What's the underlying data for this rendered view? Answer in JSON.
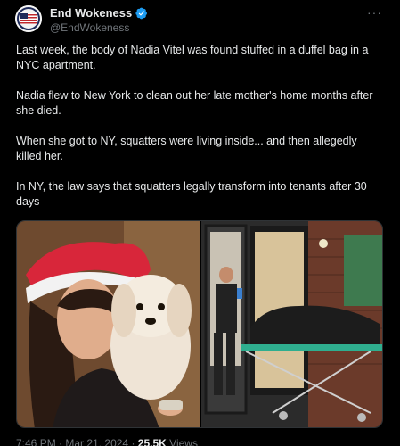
{
  "tweet": {
    "display_name": "End Wokeness",
    "handle": "@EndWokeness",
    "more_icon": "more-dots-icon",
    "verified_icon": "verified-badge-icon",
    "paragraphs": [
      "Last week, the body of Nadia Vitel was found stuffed in a duffel bag in a NYC apartment.",
      "Nadia flew to New York to clean out her late mother's home months after she died.",
      "When she got to NY, squatters were living inside... and then allegedly killed her.",
      "In NY, the law says that squatters legally transform into tenants after 30 days"
    ],
    "meta": {
      "time": "7:46 PM",
      "date": "Mar 21, 2024",
      "views_count": "25.5K",
      "views_label": "Views"
    }
  },
  "colors": {
    "background": "#000000",
    "text": "#e7e9ea",
    "secondary": "#71767b",
    "verified": "#1d9bf0",
    "border": "#2f3336"
  }
}
